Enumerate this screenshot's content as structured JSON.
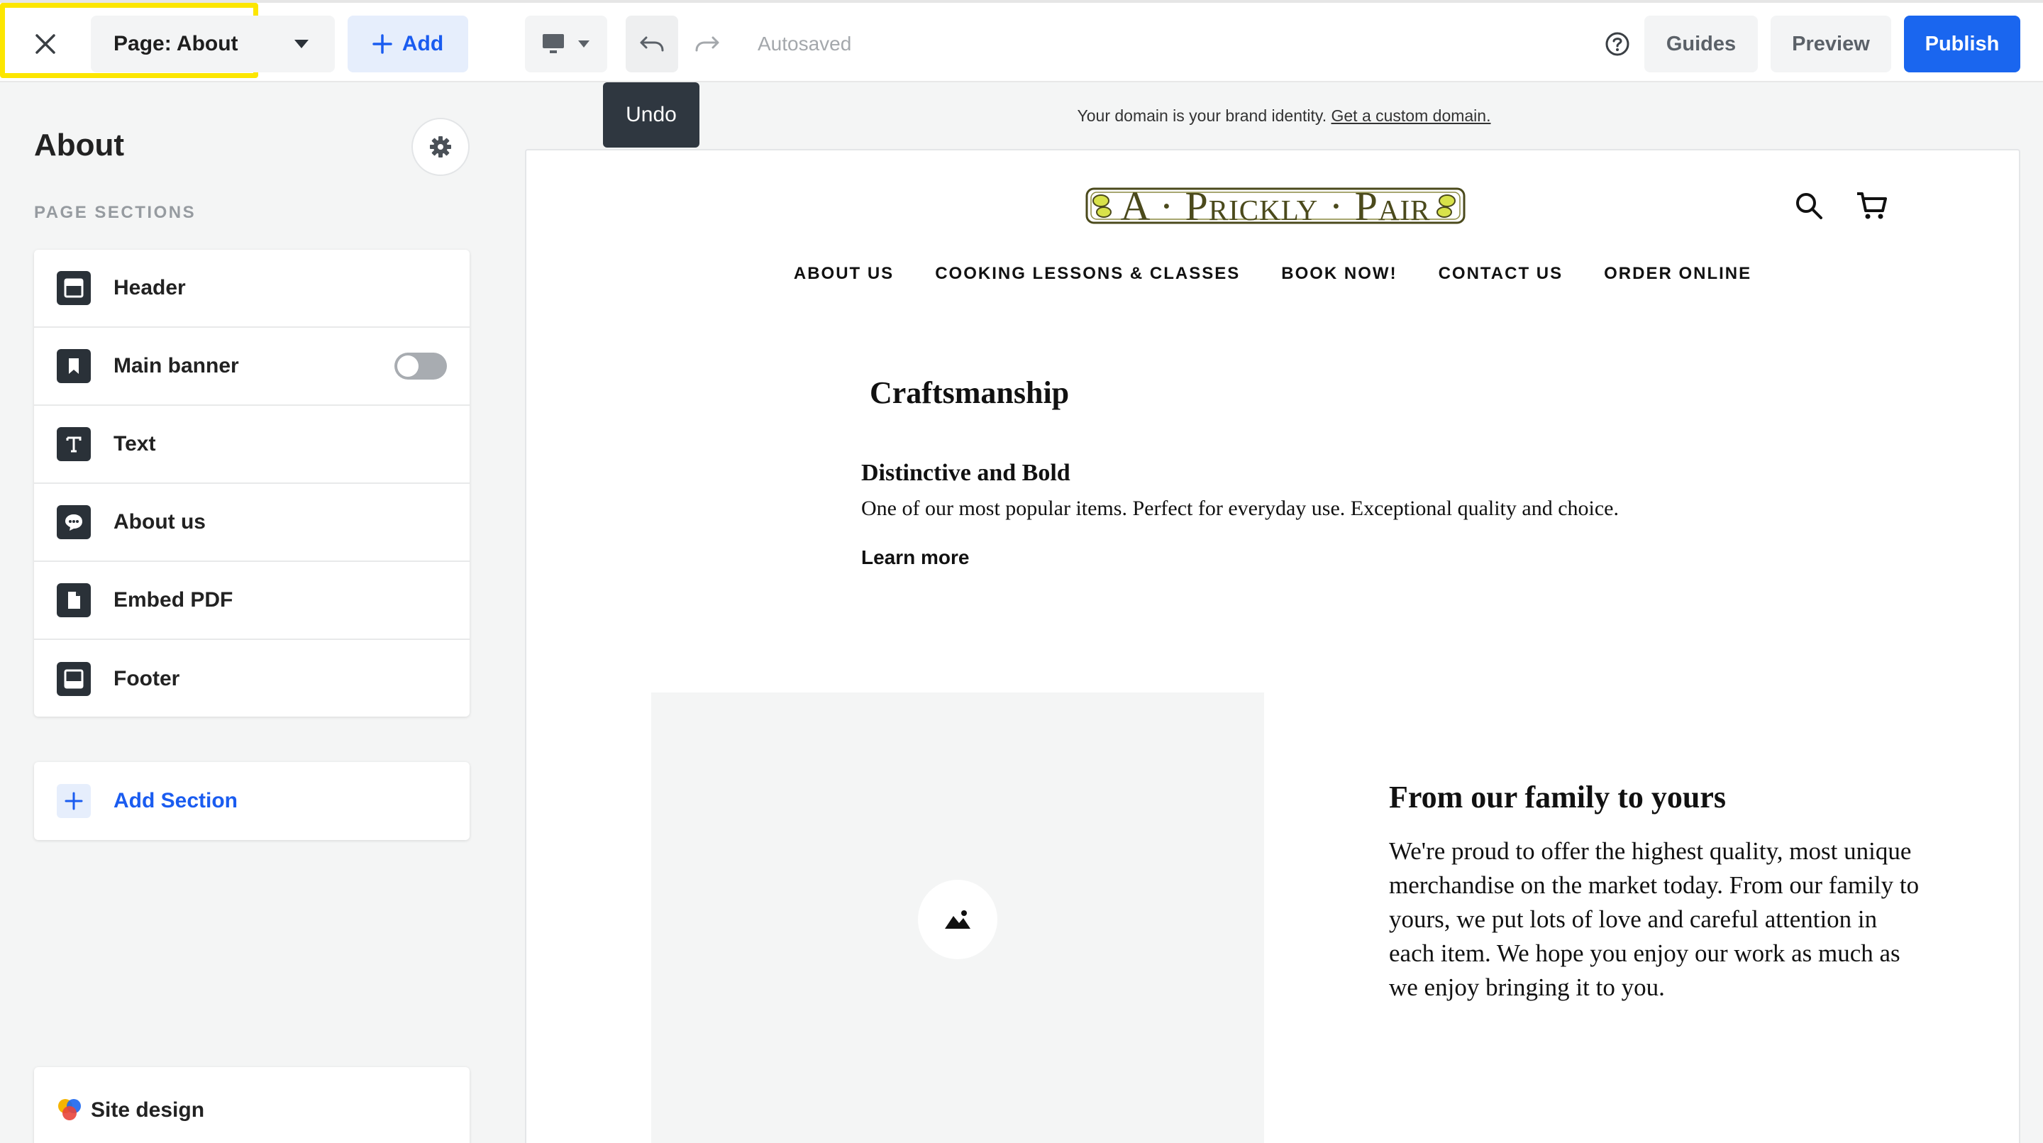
{
  "topbar": {
    "page_select_label": "Page: About",
    "add_label": "Add",
    "autosaved_label": "Autosaved",
    "guides_label": "Guides",
    "preview_label": "Preview",
    "publish_label": "Publish",
    "highlight_color": "#fce600",
    "publish_color": "#1a66ef"
  },
  "tooltip": {
    "text": "Undo"
  },
  "sidebar": {
    "title": "About",
    "subtitle": "PAGE SECTIONS",
    "sections": [
      {
        "label": "Header",
        "icon": "header-section-icon"
      },
      {
        "label": "Main banner",
        "icon": "banner-section-icon",
        "toggle": "off"
      },
      {
        "label": "Text",
        "icon": "text-section-icon"
      },
      {
        "label": "About us",
        "icon": "chat-section-icon"
      },
      {
        "label": "Embed PDF",
        "icon": "document-section-icon"
      },
      {
        "label": "Footer",
        "icon": "footer-section-icon"
      }
    ],
    "add_section_label": "Add Section",
    "site_design_label": "Site design"
  },
  "canvas": {
    "domain_note": "Your domain is your brand identity.",
    "domain_link": "Get a custom domain.",
    "site": {
      "logo_text": "A · Prickly · Pair",
      "nav": [
        "ABOUT US",
        "COOKING LESSONS & CLASSES",
        "BOOK NOW!",
        "CONTACT US",
        "ORDER ONLINE"
      ],
      "heading_1": "Craftsmanship",
      "subheading_1": "Distinctive and Bold",
      "paragraph_1": "One of our most popular items. Perfect for everyday use. Exceptional quality and choice.",
      "link_1": "Learn more",
      "heading_2": "From our family to yours",
      "paragraph_2": "We're proud to offer the highest quality, most unique merchandise on the market today. From our family to yours, we put lots of love and careful attention in each item. We hope you enjoy our work as much as we enjoy bringing it to you."
    }
  }
}
